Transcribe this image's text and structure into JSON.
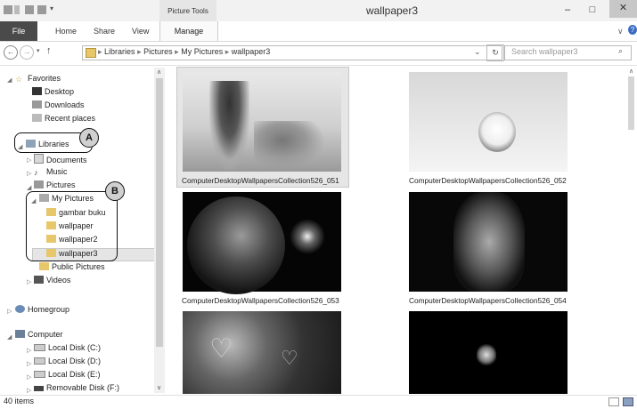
{
  "window": {
    "title": "wallpaper3",
    "context_tab_group": "Picture Tools",
    "minimize": "–",
    "maximize": "□",
    "close": "✕"
  },
  "ribbon": {
    "tabs": [
      {
        "label": "File",
        "active": true
      },
      {
        "label": "Home"
      },
      {
        "label": "Share"
      },
      {
        "label": "View"
      },
      {
        "label": "Manage"
      }
    ],
    "expand_icon": "chevron-down-icon",
    "help_icon": "help-icon"
  },
  "address": {
    "back": "←",
    "forward": "→",
    "up": "↑",
    "path": [
      "Libraries",
      "Pictures",
      "My Pictures",
      "wallpaper3"
    ],
    "separator": "▸",
    "dropdown": "⌄",
    "refresh": "↻",
    "search_placeholder": "Search wallpaper3",
    "search_glyph": "⌕"
  },
  "nav": {
    "favorites": {
      "label": "Favorites",
      "items": [
        "Desktop",
        "Downloads",
        "Recent places"
      ]
    },
    "libraries": {
      "label": "Libraries",
      "documents": "Documents",
      "music": "Music",
      "pictures": "Pictures",
      "my_pictures": "My Pictures",
      "subfolders": [
        "gambar buku",
        "wallpaper",
        "wallpaper2",
        "wallpaper3"
      ],
      "public_pictures": "Public Pictures",
      "videos": "Videos"
    },
    "homegroup": "Homegroup",
    "computer": {
      "label": "Computer",
      "drives": [
        "Local Disk (C:)",
        "Local Disk (D:)",
        "Local Disk (E:)",
        "Removable Disk (F:)"
      ]
    },
    "selected": "wallpaper3"
  },
  "callouts": {
    "a": "A",
    "b": "B"
  },
  "files": [
    {
      "name": "ComputerDesktopWallpapersCollection526_051",
      "selected": true
    },
    {
      "name": "ComputerDesktopWallpapersCollection526_052"
    },
    {
      "name": "ComputerDesktopWallpapersCollection526_053"
    },
    {
      "name": "ComputerDesktopWallpapersCollection526_054"
    },
    {
      "name": ""
    },
    {
      "name": ""
    }
  ],
  "status": {
    "item_count": "40 items"
  },
  "colors": {
    "file_tab": "#4a4a4a",
    "selection": "#e5e5e5",
    "folder": "#e8c66a"
  }
}
